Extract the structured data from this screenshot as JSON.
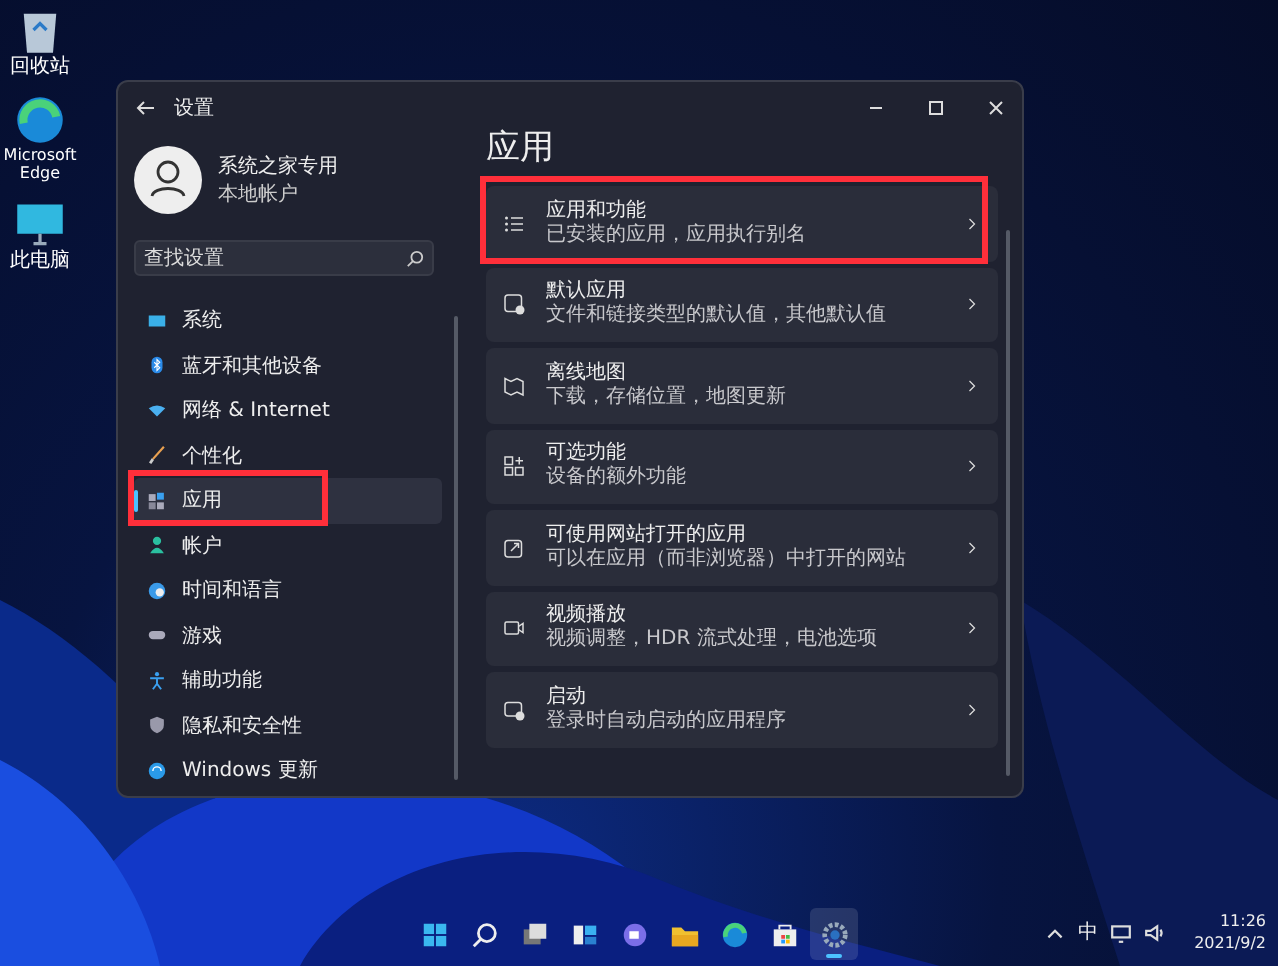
{
  "desktop_icons": [
    {
      "label": "回收站"
    },
    {
      "label": "Microsoft Edge"
    },
    {
      "label": "此电脑"
    }
  ],
  "window": {
    "title": "设置",
    "user": {
      "name": "系统之家专用",
      "account": "本地帐户"
    },
    "search": {
      "placeholder": "查找设置"
    },
    "nav": [
      {
        "label": "系统",
        "selected": false,
        "highlighted": false
      },
      {
        "label": "蓝牙和其他设备",
        "selected": false,
        "highlighted": false
      },
      {
        "label": "网络 & Internet",
        "selected": false,
        "highlighted": false
      },
      {
        "label": "个性化",
        "selected": false,
        "highlighted": false
      },
      {
        "label": "应用",
        "selected": true,
        "highlighted": true
      },
      {
        "label": "帐户",
        "selected": false,
        "highlighted": false
      },
      {
        "label": "时间和语言",
        "selected": false,
        "highlighted": false
      },
      {
        "label": "游戏",
        "selected": false,
        "highlighted": false
      },
      {
        "label": "辅助功能",
        "selected": false,
        "highlighted": false
      },
      {
        "label": "隐私和安全性",
        "selected": false,
        "highlighted": false
      },
      {
        "label": "Windows 更新",
        "selected": false,
        "highlighted": false
      }
    ],
    "page_title": "应用",
    "cards": [
      {
        "title": "应用和功能",
        "subtitle": "已安装的应用，应用执行别名",
        "highlighted": true
      },
      {
        "title": "默认应用",
        "subtitle": "文件和链接类型的默认值，其他默认值",
        "highlighted": false
      },
      {
        "title": "离线地图",
        "subtitle": "下载，存储位置，地图更新",
        "highlighted": false
      },
      {
        "title": "可选功能",
        "subtitle": "设备的额外功能",
        "highlighted": false
      },
      {
        "title": "可使用网站打开的应用",
        "subtitle": "可以在应用（而非浏览器）中打开的网站",
        "highlighted": false
      },
      {
        "title": "视频播放",
        "subtitle": "视频调整，HDR 流式处理，电池选项",
        "highlighted": false
      },
      {
        "title": "启动",
        "subtitle": "登录时自动启动的应用程序",
        "highlighted": false
      }
    ]
  },
  "taskbar": {
    "apps": [
      {
        "selected": false
      },
      {
        "selected": false
      },
      {
        "selected": false
      },
      {
        "selected": false
      },
      {
        "selected": false
      },
      {
        "selected": false
      },
      {
        "selected": false
      },
      {
        "selected": false
      },
      {
        "selected": true
      }
    ],
    "input_method": "中",
    "time": "11:26",
    "date": "2021/9/2"
  }
}
